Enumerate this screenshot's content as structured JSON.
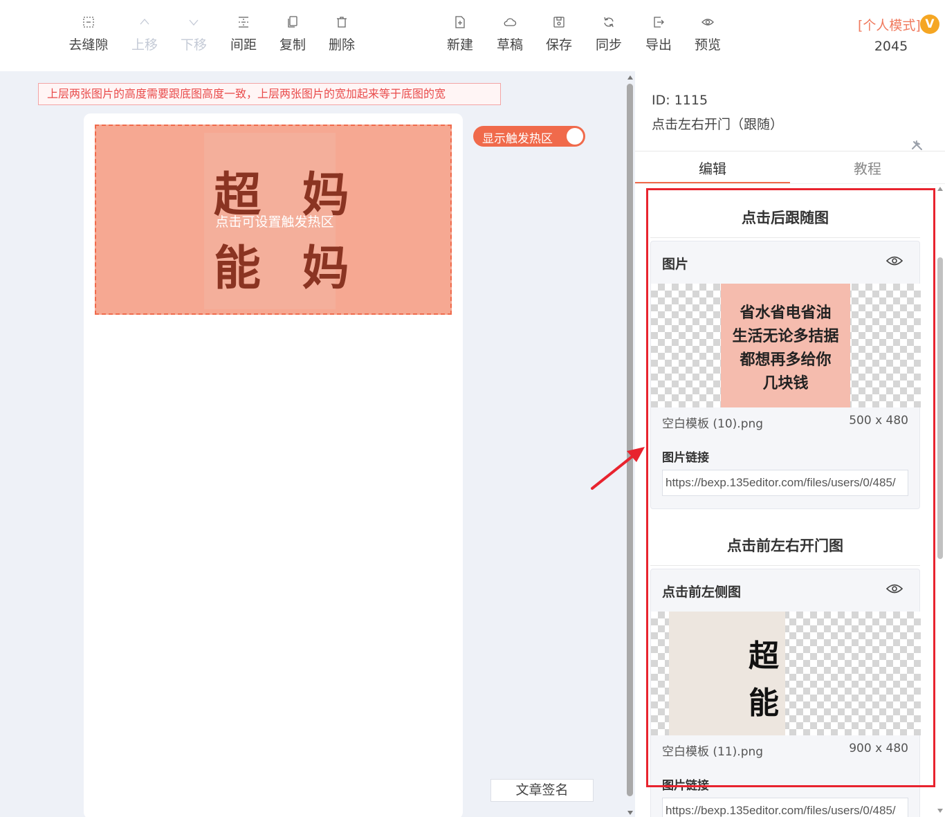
{
  "toolbar": {
    "left_buttons": [
      {
        "label": "去缝隙",
        "icon": "gap-remove-icon"
      },
      {
        "label": "上移",
        "icon": "chevron-up-icon",
        "disabled": true
      },
      {
        "label": "下移",
        "icon": "chevron-down-icon",
        "disabled": true
      },
      {
        "label": "间距",
        "icon": "spacing-icon"
      },
      {
        "label": "复制",
        "icon": "copy-icon"
      },
      {
        "label": "删除",
        "icon": "trash-icon"
      }
    ],
    "right_buttons": [
      {
        "label": "新建",
        "icon": "new-file-icon"
      },
      {
        "label": "草稿",
        "icon": "cloud-icon"
      },
      {
        "label": "保存",
        "icon": "save-icon"
      },
      {
        "label": "同步",
        "icon": "sync-icon"
      },
      {
        "label": "导出",
        "icon": "export-icon"
      },
      {
        "label": "预览",
        "icon": "eye-icon"
      }
    ],
    "mode_label": "[个人模式]",
    "vip_badge": "V",
    "count": "2045"
  },
  "canvas": {
    "notice": "上层两张图片的高度需要跟底图高度一致，上层两张图片的宽加起来等于底图的宽",
    "hotzone_hint": "点击可设置触发热区",
    "image_text_line1": "超 妈",
    "image_text_line2": "能 妈",
    "toggle_label": "显示触发热区",
    "toggle_on": true,
    "signature_button": "文章签名"
  },
  "panel": {
    "id_label": "ID: 1115",
    "component_name": "点击左右开门（跟随）",
    "tool_icon": "wrench-icon",
    "tabs": [
      {
        "label": "编辑",
        "active": true
      },
      {
        "label": "教程",
        "active": false
      }
    ],
    "section1": {
      "title": "点击后跟随图",
      "card_title": "图片",
      "image_lines": [
        "省水省电省油",
        "生活无论多拮据",
        "都想再多给你",
        "几块钱"
      ],
      "file_name": "空白模板 (10).png",
      "file_size": "500 x 480",
      "link_label": "图片链接",
      "link_value": "https://bexp.135editor.com/files/users/0/485/"
    },
    "section2": {
      "title": "点击前左右开门图",
      "card_title": "点击前左侧图",
      "image_chars": [
        "超",
        "能"
      ],
      "file_name": "空白模板 (11).png",
      "file_size": "900 x 480",
      "link_label": "图片链接",
      "link_value": "https://bexp.135editor.com/files/users/0/485/"
    }
  },
  "colors": {
    "accent": "#f06a4b",
    "annotation_red": "#e8232e",
    "notice_text": "#e94b4b",
    "vip": "#f5a623"
  }
}
